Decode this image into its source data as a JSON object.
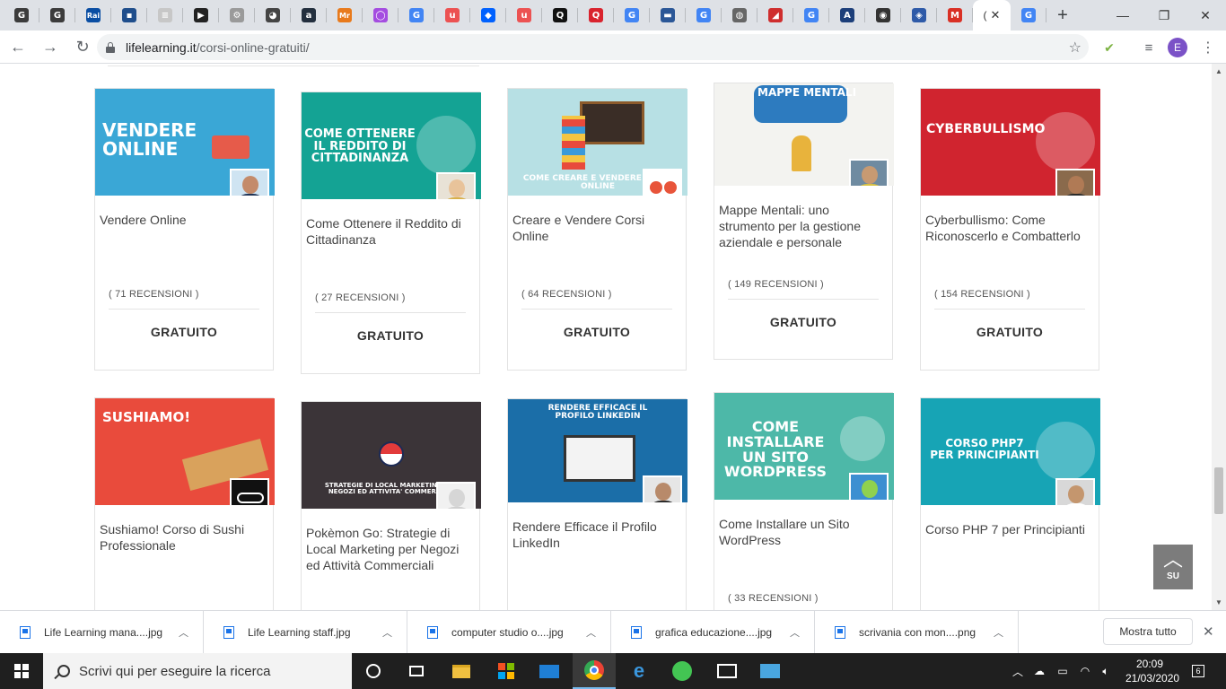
{
  "browser": {
    "tabs": [
      {
        "icon": "google-icon",
        "glyph": "G",
        "bg": "#3c3c3c"
      },
      {
        "icon": "gmail-g-icon",
        "glyph": "G",
        "bg": "#3c3c3c"
      },
      {
        "icon": "rai-icon",
        "glyph": "Rai",
        "bg": "#0a4ea3"
      },
      {
        "icon": "news-icon",
        "glyph": "▪",
        "bg": "#1f4e8c"
      },
      {
        "icon": "il-mio-libro-icon",
        "glyph": "≡",
        "bg": "#c7c7c7"
      },
      {
        "icon": "clapper-icon",
        "glyph": "▶",
        "bg": "#222222"
      },
      {
        "icon": "gear-site-icon",
        "glyph": "⚙",
        "bg": "#9a9a9a"
      },
      {
        "icon": "panda-icon",
        "glyph": "◕",
        "bg": "#444444"
      },
      {
        "icon": "amazon-icon",
        "glyph": "a",
        "bg": "#232f3e"
      },
      {
        "icon": "mr-icon",
        "glyph": "Mr",
        "bg": "#e87a1c"
      },
      {
        "icon": "ring-icon",
        "glyph": "◯",
        "bg": "#a44de0"
      },
      {
        "icon": "google-icon",
        "glyph": "G",
        "bg": "#4285f4"
      },
      {
        "icon": "udemy-icon",
        "glyph": "u",
        "bg": "#ec5252"
      },
      {
        "icon": "dropbox-icon",
        "glyph": "◆",
        "bg": "#0061fe"
      },
      {
        "icon": "udemy-icon",
        "glyph": "u",
        "bg": "#ec5252"
      },
      {
        "icon": "q-icon",
        "glyph": "Q",
        "bg": "#111111"
      },
      {
        "icon": "q-red-icon",
        "glyph": "Q",
        "bg": "#d9232e"
      },
      {
        "icon": "google-icon",
        "glyph": "G",
        "bg": "#4285f4"
      },
      {
        "icon": "briefcase-icon",
        "glyph": "▬",
        "bg": "#2b5797"
      },
      {
        "icon": "google-icon",
        "glyph": "G",
        "bg": "#4285f4"
      },
      {
        "icon": "globe-icon",
        "glyph": "◍",
        "bg": "#666666"
      },
      {
        "icon": "triangle-logo-icon",
        "glyph": "◢",
        "bg": "#cf2e2e"
      },
      {
        "icon": "google-icon",
        "glyph": "G",
        "bg": "#4285f4"
      },
      {
        "icon": "a-circle-icon",
        "glyph": "A",
        "bg": "#1d3f7a"
      },
      {
        "icon": "owl-icon",
        "glyph": "◉",
        "bg": "#333333"
      },
      {
        "icon": "shield-icon",
        "glyph": "◈",
        "bg": "#2e5aa8"
      },
      {
        "icon": "gmail-icon",
        "glyph": "M",
        "bg": "#d93025"
      }
    ],
    "active_tab_label": "(",
    "after_active_tab": {
      "icon": "google-icon",
      "glyph": "G",
      "bg": "#4285f4"
    },
    "url_domain": "lifelearning.it",
    "url_path": "/corsi-online-gratuiti/",
    "profile_initial": "E"
  },
  "courses": [
    {
      "title": "Vendere Online",
      "reviews": "( 71 RECENSIONI )",
      "price": "GRATUITO",
      "thumb_text": "VENDERE\nONLINE",
      "bg": "#3aa7d6",
      "author_bg": "#cfe4f2",
      "author_skin": "#c48b6a",
      "author_shirt": "#1e3355"
    },
    {
      "title": "Come Ottenere il Reddito di Cittadinanza",
      "reviews": "( 27 RECENSIONI )",
      "price": "GRATUITO",
      "thumb_text": "COME OTTENERE\nIL REDDITO DI\nCITTADINANZA",
      "bg": "#14a394",
      "author_bg": "#e8e2d6",
      "author_skin": "#e8c39a",
      "author_shirt": "#d8b04a"
    },
    {
      "title": "Creare e Vendere Corsi Online",
      "reviews": "( 64 RECENSIONI )",
      "price": "GRATUITO",
      "thumb_text": "COME CREARE E VENDERE CORSI ONLINE",
      "bg": "#b7e0e4",
      "author_bg": "#ffffff",
      "author_skin": "#e8543a",
      "author_shirt": "#ffffff"
    },
    {
      "title": "Mappe Mentali: uno strumento per la gestione aziendale e personale",
      "reviews": "( 149 RECENSIONI )",
      "price": "GRATUITO",
      "thumb_text": "MAPPE MENTALI",
      "bg": "#f3f3f0",
      "author_bg": "#6f8ba1",
      "author_skin": "#c79a72",
      "author_shirt": "#d9c23f"
    },
    {
      "title": "Cyberbullismo: Come Riconoscerlo e Combatterlo",
      "reviews": "( 154 RECENSIONI )",
      "price": "GRATUITO",
      "thumb_text": "CYBERBULLISMO",
      "bg": "#d0242f",
      "author_bg": "#8a6a4c",
      "author_skin": "#b07a55",
      "author_shirt": "#2b2b2b"
    },
    {
      "title": "Sushiamo! Corso di Sushi Professionale",
      "reviews": "",
      "price": "",
      "thumb_text": "SUSHIAMO!",
      "bg": "#e94b3c",
      "author_bg": "#111111",
      "author_skin": "#ffffff",
      "author_shirt": "#111111"
    },
    {
      "title": "Pokèmon Go: Strategie di Local Marketing per Negozi ed Attività Commerciali",
      "reviews": "",
      "price": "",
      "thumb_text": "STRATEGIE DI LOCAL MARKETING PER\nNEGOZI ED ATTIVITA' COMMERCIALI",
      "bg": "#3b3438",
      "author_bg": "#f1f1f1",
      "author_skin": "#d6d6d6",
      "author_shirt": "#cfcfcf"
    },
    {
      "title": "Rendere Efficace il Profilo LinkedIn",
      "reviews": "",
      "price": "",
      "thumb_text": "RENDERE EFFICACE IL\nPROFILO LINKEDIN",
      "bg": "#1b6ea8",
      "author_bg": "#e6e6e6",
      "author_skin": "#b88a6a",
      "author_shirt": "#2c2c2c"
    },
    {
      "title": "Come Installare un Sito WordPress",
      "reviews": "( 33 RECENSIONI )",
      "price": "",
      "thumb_text": "COME\nINSTALLARE\nUN SITO\nWORDPRESS",
      "bg": "#4db8a8",
      "author_bg": "#3c8fd1",
      "author_skin": "#8fd14f",
      "author_shirt": "#3c8fd1"
    },
    {
      "title": "Corso PHP 7 per Principianti",
      "reviews": "",
      "price": "",
      "thumb_text": "CORSO PHP7\nPER PRINCIPIANTI",
      "bg": "#17a4b5",
      "author_bg": "#d8d8d8",
      "author_skin": "#c4966e",
      "author_shirt": "#ffffff"
    }
  ],
  "back_to_top_label": "SU",
  "downloads": [
    {
      "name": "Life Learning mana....jpg"
    },
    {
      "name": "Life Learning staff.jpg"
    },
    {
      "name": "computer studio o....jpg"
    },
    {
      "name": "grafica educazione....jpg"
    },
    {
      "name": "scrivania con mon....png"
    }
  ],
  "show_all_label": "Mostra tutto",
  "taskbar": {
    "search_placeholder": "Scrivi qui per eseguire la ricerca",
    "time": "20:09",
    "date": "21/03/2020",
    "notification_count": "6"
  }
}
